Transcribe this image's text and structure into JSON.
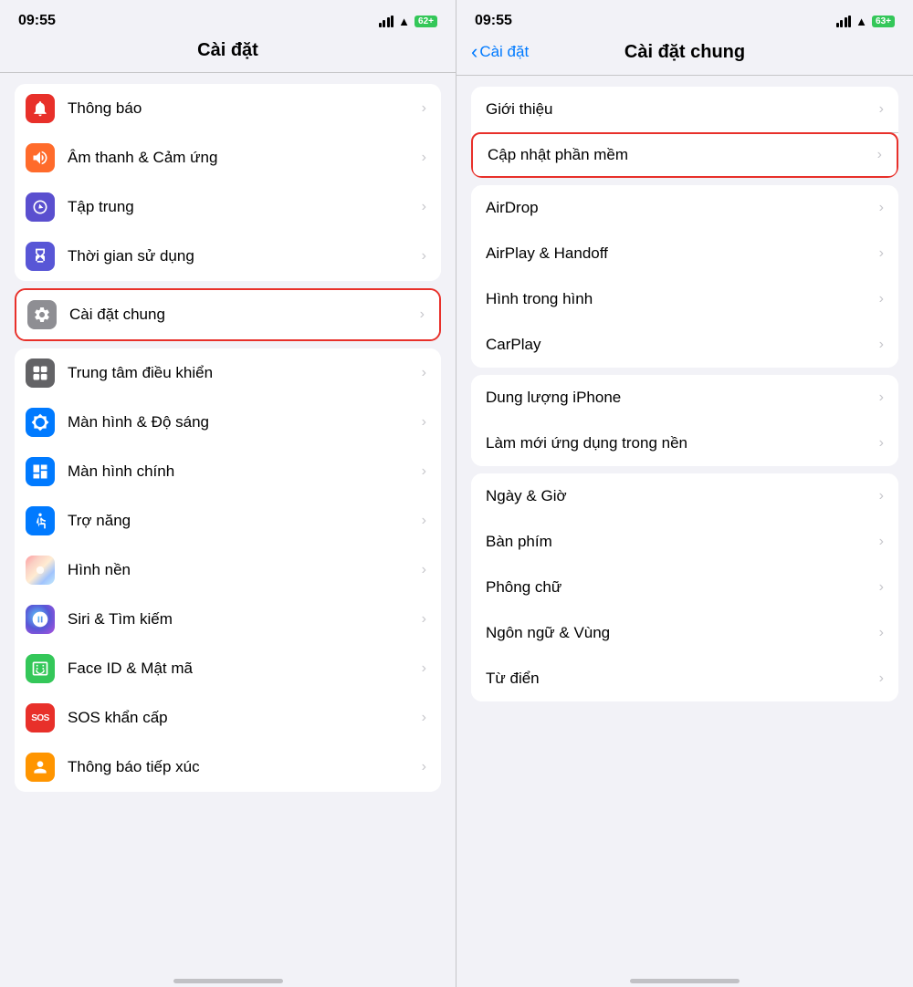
{
  "left": {
    "status": {
      "time": "09:55",
      "battery": "62+"
    },
    "title": "Cài đặt",
    "groups": [
      {
        "id": "group1",
        "items": [
          {
            "id": "thong-bao",
            "label": "Thông báo",
            "iconColor": "icon-red",
            "icon": "bell"
          },
          {
            "id": "am-thanh",
            "label": "Âm thanh & Cảm ứng",
            "iconColor": "icon-orange",
            "icon": "sound"
          },
          {
            "id": "tap-trung",
            "label": "Tập trung",
            "iconColor": "icon-purple",
            "icon": "focus"
          },
          {
            "id": "thoi-gian",
            "label": "Thời gian sử dụng",
            "iconColor": "icon-blue-purple",
            "icon": "hourglass"
          }
        ]
      },
      {
        "id": "group2",
        "items": [
          {
            "id": "cai-dat-chung",
            "label": "Cài đặt chung",
            "iconColor": "icon-gray",
            "icon": "gear",
            "highlighted": true
          }
        ]
      },
      {
        "id": "group3",
        "items": [
          {
            "id": "trung-tam",
            "label": "Trung tâm điều khiển",
            "iconColor": "icon-dark-gray",
            "icon": "control"
          },
          {
            "id": "man-hinh-do-sang",
            "label": "Màn hình & Độ sáng",
            "iconColor": "icon-blue",
            "icon": "brightness"
          },
          {
            "id": "man-hinh-chinh",
            "label": "Màn hình chính",
            "iconColor": "icon-blue",
            "icon": "homescreen"
          },
          {
            "id": "tro-nang",
            "label": "Trợ năng",
            "iconColor": "icon-blue",
            "icon": "accessibility"
          },
          {
            "id": "hinh-nen",
            "label": "Hình nền",
            "iconColor": "icon-multi",
            "icon": "wallpaper"
          },
          {
            "id": "siri",
            "label": "Siri & Tìm kiếm",
            "iconColor": "icon-siri",
            "icon": "siri"
          },
          {
            "id": "face-id",
            "label": "Face ID & Mật mã",
            "iconColor": "icon-faceid",
            "icon": "faceid"
          },
          {
            "id": "sos",
            "label": "SOS khẩn cấp",
            "iconColor": "icon-sos",
            "icon": "sos"
          },
          {
            "id": "thong-bao-tiep-xuc",
            "label": "Thông báo tiếp xúc",
            "iconColor": "icon-contact",
            "icon": "contact"
          }
        ]
      }
    ]
  },
  "right": {
    "status": {
      "time": "09:55",
      "battery": "63+"
    },
    "back_label": "Cài đặt",
    "title": "Cài đặt chung",
    "groups": [
      {
        "id": "rgroup1",
        "items": [
          {
            "id": "gioi-thieu",
            "label": "Giới thiệu"
          },
          {
            "id": "cap-nhat",
            "label": "Cập nhật phần mềm",
            "highlighted": true
          }
        ]
      },
      {
        "id": "rgroup2",
        "items": [
          {
            "id": "airdrop",
            "label": "AirDrop"
          },
          {
            "id": "airplay",
            "label": "AirPlay & Handoff"
          },
          {
            "id": "hinh-trong-hinh",
            "label": "Hình trong hình"
          },
          {
            "id": "carplay",
            "label": "CarPlay"
          }
        ]
      },
      {
        "id": "rgroup3",
        "items": [
          {
            "id": "dung-luong",
            "label": "Dung lượng iPhone"
          },
          {
            "id": "lam-moi",
            "label": "Làm mới ứng dụng trong nền"
          }
        ]
      },
      {
        "id": "rgroup4",
        "items": [
          {
            "id": "ngay-gio",
            "label": "Ngày & Giờ"
          },
          {
            "id": "ban-phim",
            "label": "Bàn phím"
          },
          {
            "id": "phong-chu",
            "label": "Phông chữ"
          },
          {
            "id": "ngon-ngu",
            "label": "Ngôn ngữ & Vùng"
          },
          {
            "id": "tu-dien",
            "label": "Từ điển"
          }
        ]
      }
    ]
  },
  "chevron": "›",
  "back_chevron": "‹"
}
